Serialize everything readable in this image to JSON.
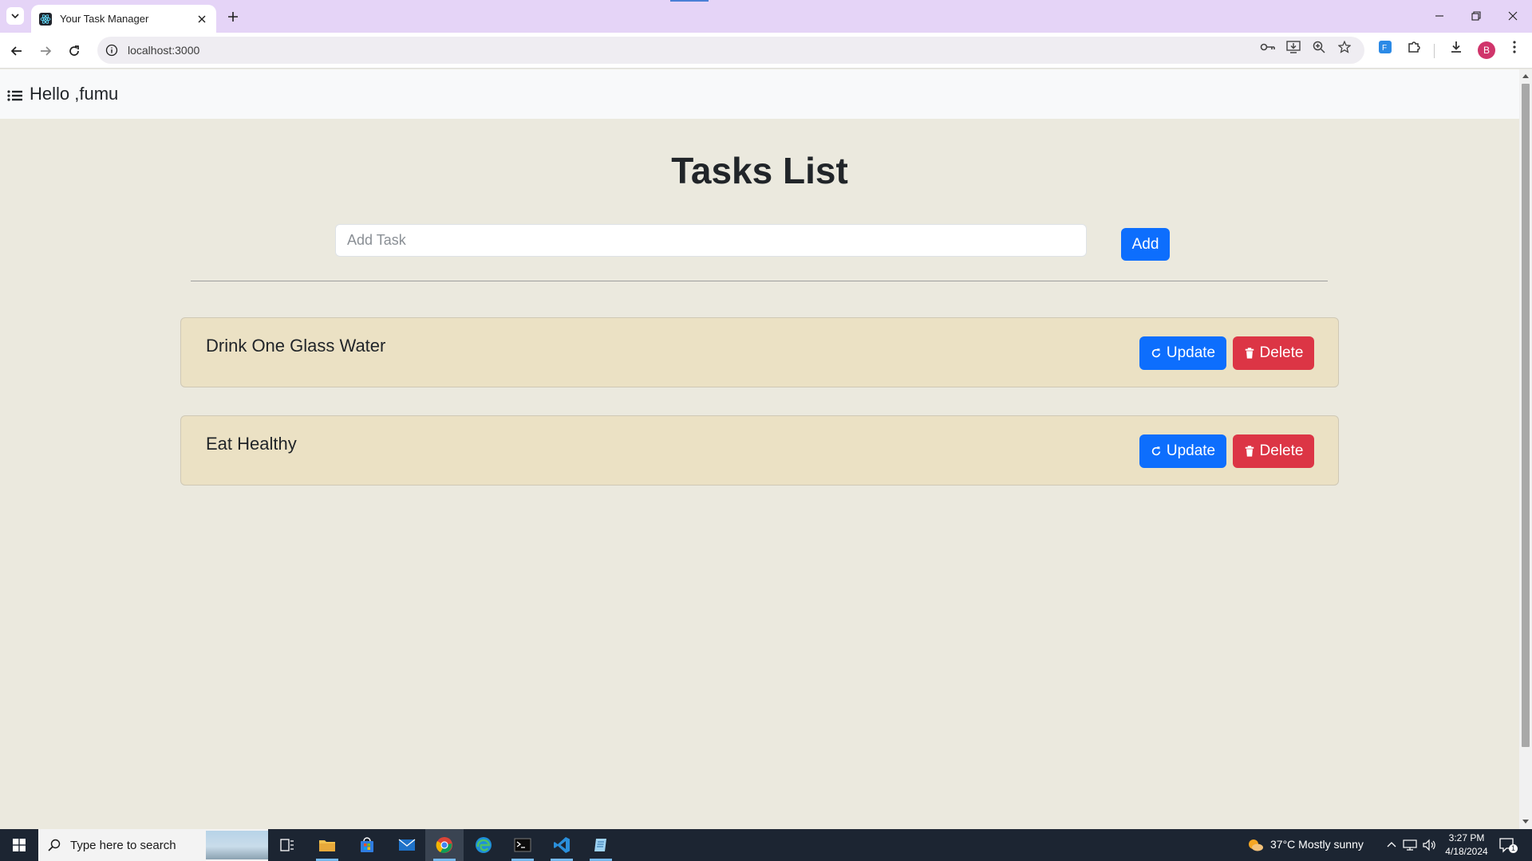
{
  "browser": {
    "tab_title": "Your Task Manager",
    "url": "localhost:3000",
    "profile_initial": "B"
  },
  "navbar": {
    "greeting": "Hello ,fumu"
  },
  "main": {
    "title": "Tasks List",
    "input_placeholder": "Add Task",
    "input_value": "",
    "add_label": "Add"
  },
  "tasks": [
    {
      "text": "Drink One Glass Water",
      "update_label": "Update",
      "delete_label": "Delete"
    },
    {
      "text": "Eat Healthy",
      "update_label": "Update",
      "delete_label": "Delete"
    }
  ],
  "taskbar": {
    "search_placeholder": "Type here to search",
    "weather": "37°C  Mostly sunny",
    "time": "3:27 PM",
    "date": "4/18/2024",
    "notification_count": "1"
  },
  "colors": {
    "primary": "#0d6efd",
    "danger": "#dc3545",
    "page_bg": "#ebe9de",
    "card_bg": "#ebe1c4",
    "tabstrip_bg": "#e5d4f7"
  }
}
